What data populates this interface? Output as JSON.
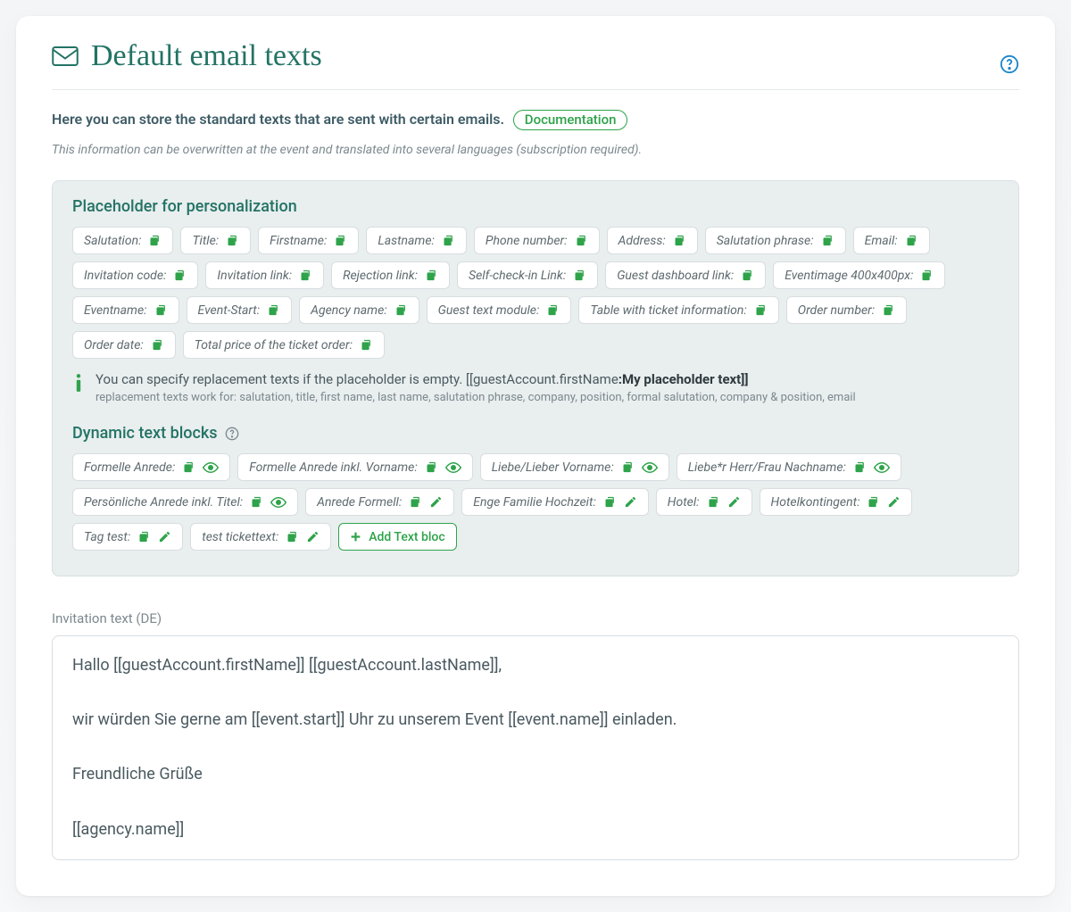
{
  "page_title": "Default email texts",
  "intro": "Here you can store the standard texts that are sent with certain emails.",
  "doc_link": "Documentation",
  "note": "This information can be overwritten at the event and translated into several languages (subscription required).",
  "panel": {
    "placeholders_title": "Placeholder for personalization",
    "placeholders": [
      "Salutation",
      "Title",
      "Firstname",
      "Lastname",
      "Phone number",
      "Address",
      "Salutation phrase",
      "Email",
      "Invitation code",
      "Invitation link",
      "Rejection link",
      "Self-check-in Link",
      "Guest dashboard link",
      "Eventimage 400x400px",
      "Eventname",
      "Event-Start",
      "Agency name",
      "Guest text module",
      "Table with ticket information",
      "Order number",
      "Order date",
      "Total price of the ticket order"
    ],
    "info_line_prefix": "You can specify replacement texts if the placeholder is empty. [[guestAccount.firstName",
    "info_line_bold": ":My placeholder text]]",
    "info_subline": "replacement texts work for: salutation, title, first name, last name, salutation phrase, company, position, formal salutation, company & position, email",
    "dynamic_title": "Dynamic text blocks",
    "dynamic_blocks": [
      {
        "label": "Formelle Anrede",
        "actions": [
          "copy",
          "eye"
        ]
      },
      {
        "label": "Formelle Anrede inkl. Vorname",
        "actions": [
          "copy",
          "eye"
        ]
      },
      {
        "label": "Liebe/Lieber Vorname",
        "actions": [
          "copy",
          "eye"
        ]
      },
      {
        "label": "Liebe*r Herr/Frau Nachname",
        "actions": [
          "copy",
          "eye"
        ]
      },
      {
        "label": "Persönliche Anrede inkl. Titel",
        "actions": [
          "copy",
          "eye"
        ]
      },
      {
        "label": "Anrede Formell",
        "actions": [
          "copy",
          "edit"
        ]
      },
      {
        "label": "Enge Familie Hochzeit",
        "actions": [
          "copy",
          "edit"
        ]
      },
      {
        "label": "Hotel",
        "actions": [
          "copy",
          "edit"
        ]
      },
      {
        "label": "Hotelkontingent",
        "actions": [
          "copy",
          "edit"
        ]
      },
      {
        "label": "Tag test",
        "actions": [
          "copy",
          "edit"
        ]
      },
      {
        "label": "test tickettext",
        "actions": [
          "copy",
          "edit"
        ]
      }
    ],
    "add_text_bloc": "Add Text bloc"
  },
  "invitation_label": "Invitation text (DE)",
  "invitation_body": "Hallo [[guestAccount.firstName]] [[guestAccount.lastName]],\n\nwir würden Sie gerne am [[event.start]] Uhr zu unserem Event  [[event.name]] einladen.\n\nFreundliche Grüße\n\n[[agency.name]]"
}
